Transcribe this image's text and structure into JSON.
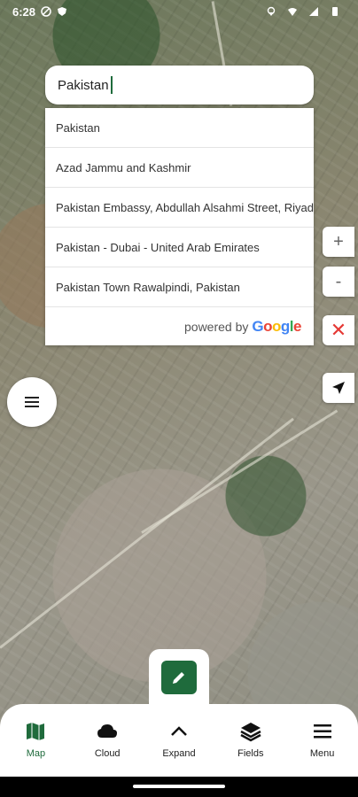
{
  "status": {
    "time": "6:28"
  },
  "search": {
    "value": "Pakistan"
  },
  "suggestions": [
    "Pakistan",
    "Azad Jammu and Kashmir",
    "Pakistan Embassy, Abdullah Alsahmi Street, Riyadh",
    "Pakistan - Dubai - United Arab Emirates",
    "Pakistan Town Rawalpindi, Pakistan"
  ],
  "powered_by": {
    "prefix": "powered by",
    "brand": "Google"
  },
  "controls": {
    "zoom_in": "+",
    "zoom_out": "-",
    "close": "✕"
  },
  "nav": [
    {
      "label": "Map",
      "icon": "map-icon",
      "active": true
    },
    {
      "label": "Cloud",
      "icon": "cloud-icon",
      "active": false
    },
    {
      "label": "Expand",
      "icon": "chevron-up-icon",
      "active": false
    },
    {
      "label": "Fields",
      "icon": "layers-icon",
      "active": false
    },
    {
      "label": "Menu",
      "icon": "hamburger-icon",
      "active": false
    }
  ],
  "colors": {
    "accent": "#1f6b3c",
    "close": "#e53935"
  }
}
